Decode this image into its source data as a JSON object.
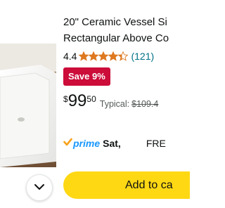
{
  "product": {
    "title_line1": "20\" Ceramic Vessel Si",
    "title_line2": "Rectangular Above Co",
    "rating": "4.4",
    "stars_value": 4.4,
    "review_count": "(121)",
    "save_badge": "Save 9%",
    "price": {
      "currency": "$",
      "whole": "99",
      "fraction": "50"
    },
    "typical_label": "Typical:",
    "typical_price": "$109.4"
  },
  "delivery": {
    "prime_label": "prime",
    "day": "Sat,",
    "free_label": "FRE"
  },
  "actions": {
    "add_to_cart": "Add to ca"
  },
  "colors": {
    "star": "#de7921",
    "badge": "#cc0c39",
    "prime": "#1a98ff",
    "prime_check": "#f7a21b",
    "button": "#ffd814",
    "link": "#007185"
  },
  "icons": {
    "expand": "chevron-down-icon",
    "rating": "star-icon",
    "prime": "prime-check-icon"
  }
}
